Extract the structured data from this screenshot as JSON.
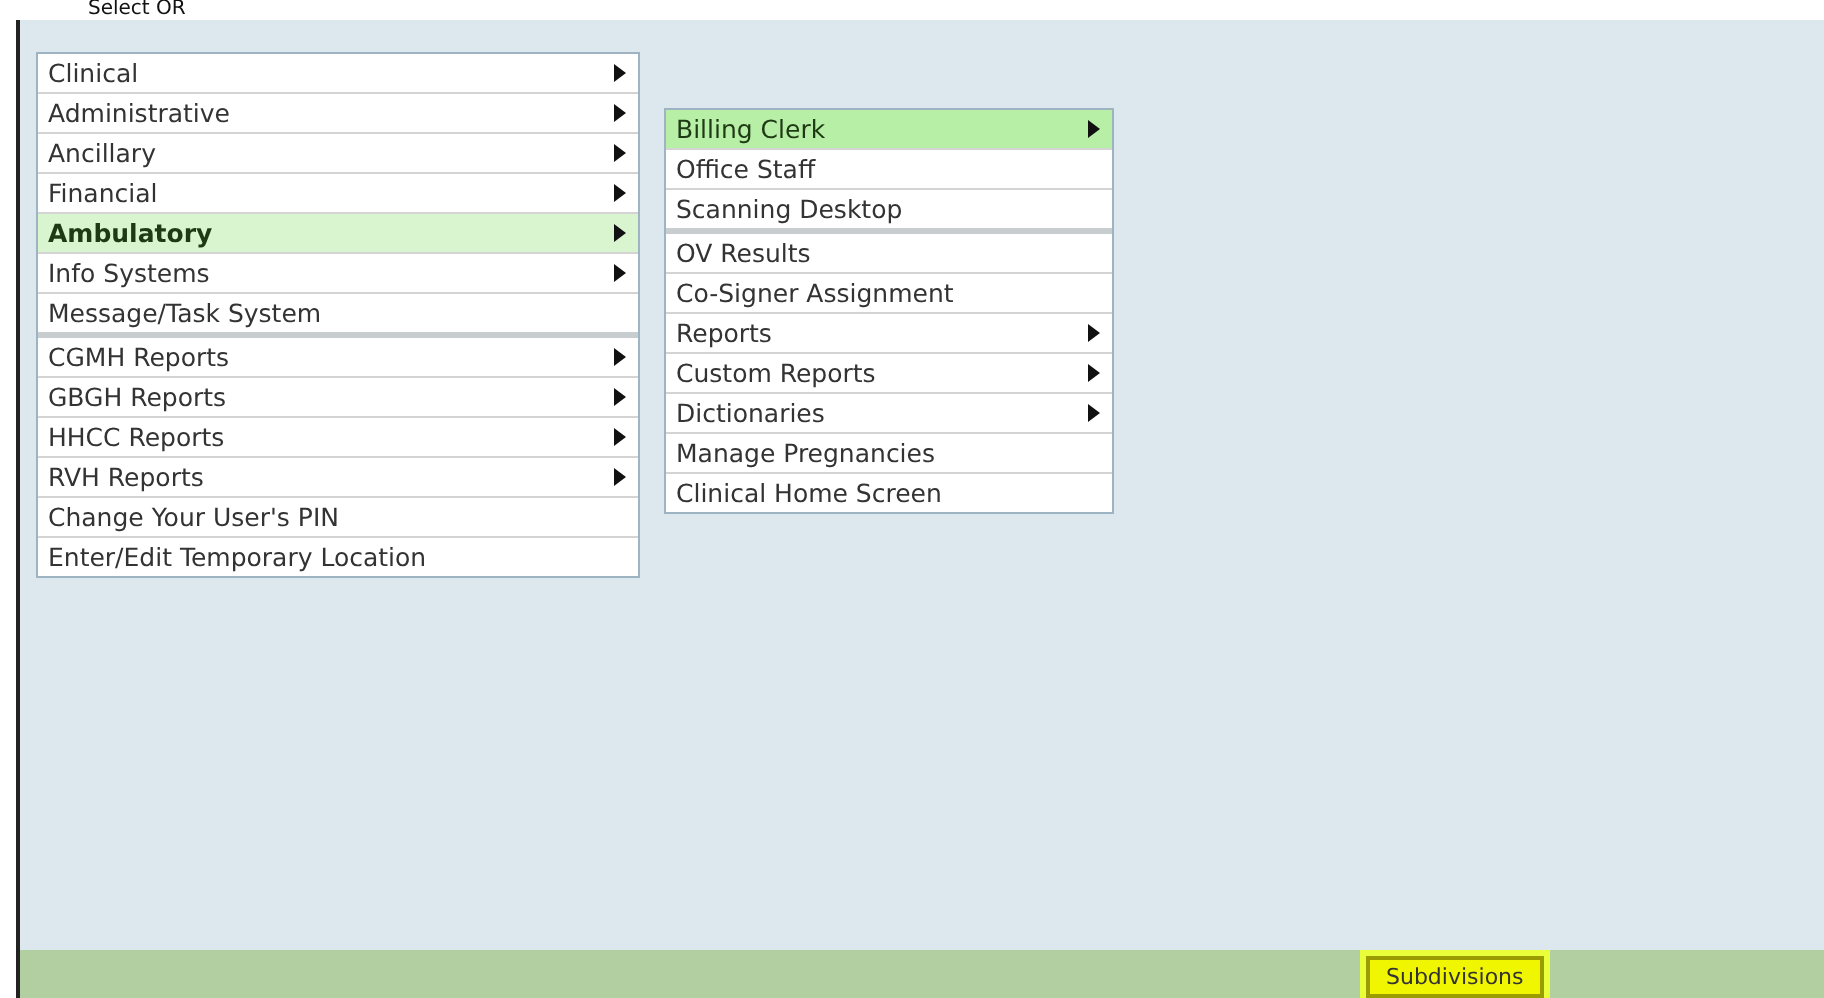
{
  "heading": "Select OR",
  "menus": [
    {
      "items": [
        {
          "label": "Clinical",
          "submenu": true,
          "selected": false,
          "group_end": false
        },
        {
          "label": "Administrative",
          "submenu": true,
          "selected": false,
          "group_end": false
        },
        {
          "label": "Ancillary",
          "submenu": true,
          "selected": false,
          "group_end": false
        },
        {
          "label": "Financial",
          "submenu": true,
          "selected": false,
          "group_end": false
        },
        {
          "label": "Ambulatory",
          "submenu": true,
          "selected": true,
          "group_end": false
        },
        {
          "label": "Info Systems",
          "submenu": true,
          "selected": false,
          "group_end": false
        },
        {
          "label": "Message/Task System",
          "submenu": false,
          "selected": false,
          "group_end": true
        },
        {
          "label": "CGMH Reports",
          "submenu": true,
          "selected": false,
          "group_end": false
        },
        {
          "label": "GBGH Reports",
          "submenu": true,
          "selected": false,
          "group_end": false
        },
        {
          "label": "HHCC Reports",
          "submenu": true,
          "selected": false,
          "group_end": false
        },
        {
          "label": "RVH Reports",
          "submenu": true,
          "selected": false,
          "group_end": false
        },
        {
          "label": "Change Your User's PIN",
          "submenu": false,
          "selected": false,
          "group_end": false
        },
        {
          "label": "Enter/Edit Temporary Location",
          "submenu": false,
          "selected": false,
          "group_end": false
        }
      ]
    },
    {
      "items": [
        {
          "label": "Billing Clerk",
          "submenu": true,
          "selected": true,
          "group_end": false
        },
        {
          "label": "Office Staff",
          "submenu": false,
          "selected": false,
          "group_end": false
        },
        {
          "label": "Scanning Desktop",
          "submenu": false,
          "selected": false,
          "group_end": true
        },
        {
          "label": "OV Results",
          "submenu": false,
          "selected": false,
          "group_end": false
        },
        {
          "label": "Co-Signer Assignment",
          "submenu": false,
          "selected": false,
          "group_end": false
        },
        {
          "label": "Reports",
          "submenu": true,
          "selected": false,
          "group_end": false
        },
        {
          "label": "Custom Reports",
          "submenu": true,
          "selected": false,
          "group_end": false
        },
        {
          "label": "Dictionaries",
          "submenu": true,
          "selected": false,
          "group_end": false
        },
        {
          "label": "Manage Pregnancies",
          "submenu": false,
          "selected": false,
          "group_end": false
        },
        {
          "label": "Clinical Home Screen",
          "submenu": false,
          "selected": false,
          "group_end": false
        }
      ]
    }
  ],
  "footer": {
    "button": "Subdivisions"
  }
}
